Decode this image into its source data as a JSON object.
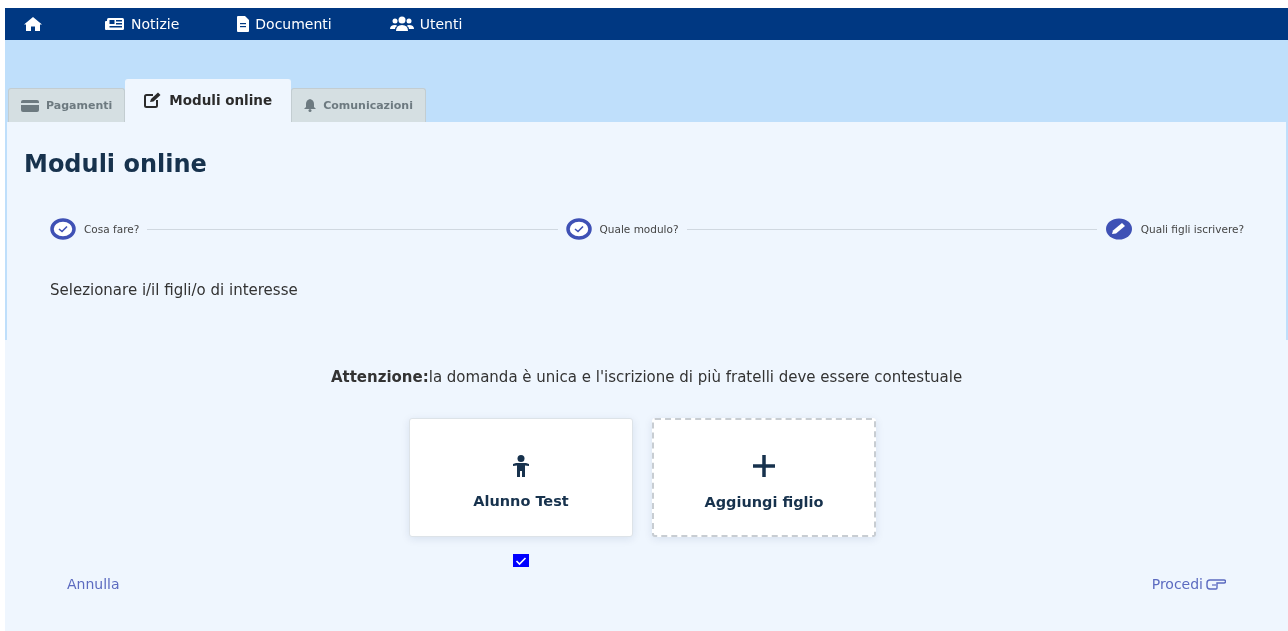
{
  "nav": [
    {
      "kind": "home"
    },
    {
      "kind": "news",
      "label": "Notizie"
    },
    {
      "kind": "doc",
      "label": "Documenti"
    },
    {
      "kind": "users",
      "label": "Utenti"
    }
  ],
  "tabs": [
    {
      "kind": "card",
      "label": "Pagamenti",
      "selected": false
    },
    {
      "kind": "edit",
      "label": "Moduli online",
      "selected": true
    },
    {
      "kind": "bell",
      "label": "Comunicazioni",
      "selected": false
    }
  ],
  "title": "Moduli online",
  "steps": [
    {
      "kind": "done",
      "label": "Cosa fare?"
    },
    {
      "kind": "done",
      "label": "Quale modulo?"
    },
    {
      "kind": "current",
      "label": "Quali figli iscrivere?"
    }
  ],
  "instruction": "Selezionare i/il figli/o di interesse",
  "notice": "**Attenzione:**la domanda è unica e l'iscrizione di più fratelli deve essere contestuale",
  "cards": [
    {
      "kind": "child",
      "label": "Alunno Test",
      "checked": true
    },
    {
      "kind": "add",
      "label": "Aggiungi figlio"
    }
  ],
  "footer": {
    "cancel": "Annulla",
    "proceed": "Procedi"
  }
}
